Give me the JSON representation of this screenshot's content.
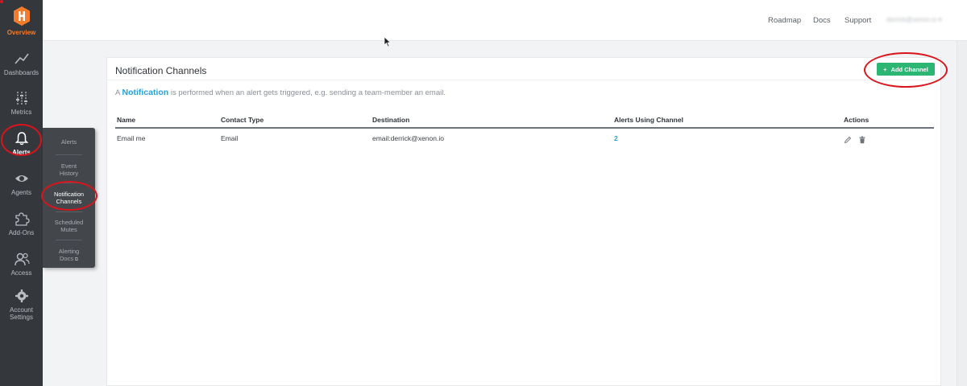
{
  "sidebar": {
    "items": [
      {
        "label": "Overview",
        "icon": "logo-icon"
      },
      {
        "label": "Dashboards",
        "icon": "chart-line-icon"
      },
      {
        "label": "Metrics",
        "icon": "sliders-icon"
      },
      {
        "label": "Alerts",
        "icon": "bell-icon"
      },
      {
        "label": "Agents",
        "icon": "eye-icon"
      },
      {
        "label": "Add-Ons",
        "icon": "puzzle-icon"
      },
      {
        "label": "Access",
        "icon": "users-icon"
      },
      {
        "label": "Account Settings",
        "icon": "gear-icon"
      }
    ]
  },
  "flyout": {
    "items": [
      {
        "label": "Alerts"
      },
      {
        "label": "Event History"
      },
      {
        "label": "Notification Channels"
      },
      {
        "label": "Scheduled Mutes"
      },
      {
        "label": "Alerting Docs"
      }
    ]
  },
  "topbar": {
    "links": [
      "Roadmap",
      "Docs",
      "Support"
    ],
    "user": "derrick@xenon.io"
  },
  "card": {
    "title": "Notification Channels",
    "add_button": "Add Channel",
    "description_prefix": "A ",
    "description_highlight": "Notification",
    "description_suffix": " is performed when an alert gets triggered, e.g. sending a team-member an email."
  },
  "table": {
    "columns": [
      "Name",
      "Contact Type",
      "Destination",
      "Alerts Using Channel",
      "Actions"
    ],
    "rows": [
      {
        "name": "Email me",
        "contact_type": "Email",
        "destination": "email:derrick@xenon.io",
        "alerts_using": "2"
      }
    ]
  },
  "colors": {
    "accent": "#2bb673",
    "link": "#1fa3d9",
    "brand": "#f47b2a",
    "annotation": "#d9141b"
  }
}
